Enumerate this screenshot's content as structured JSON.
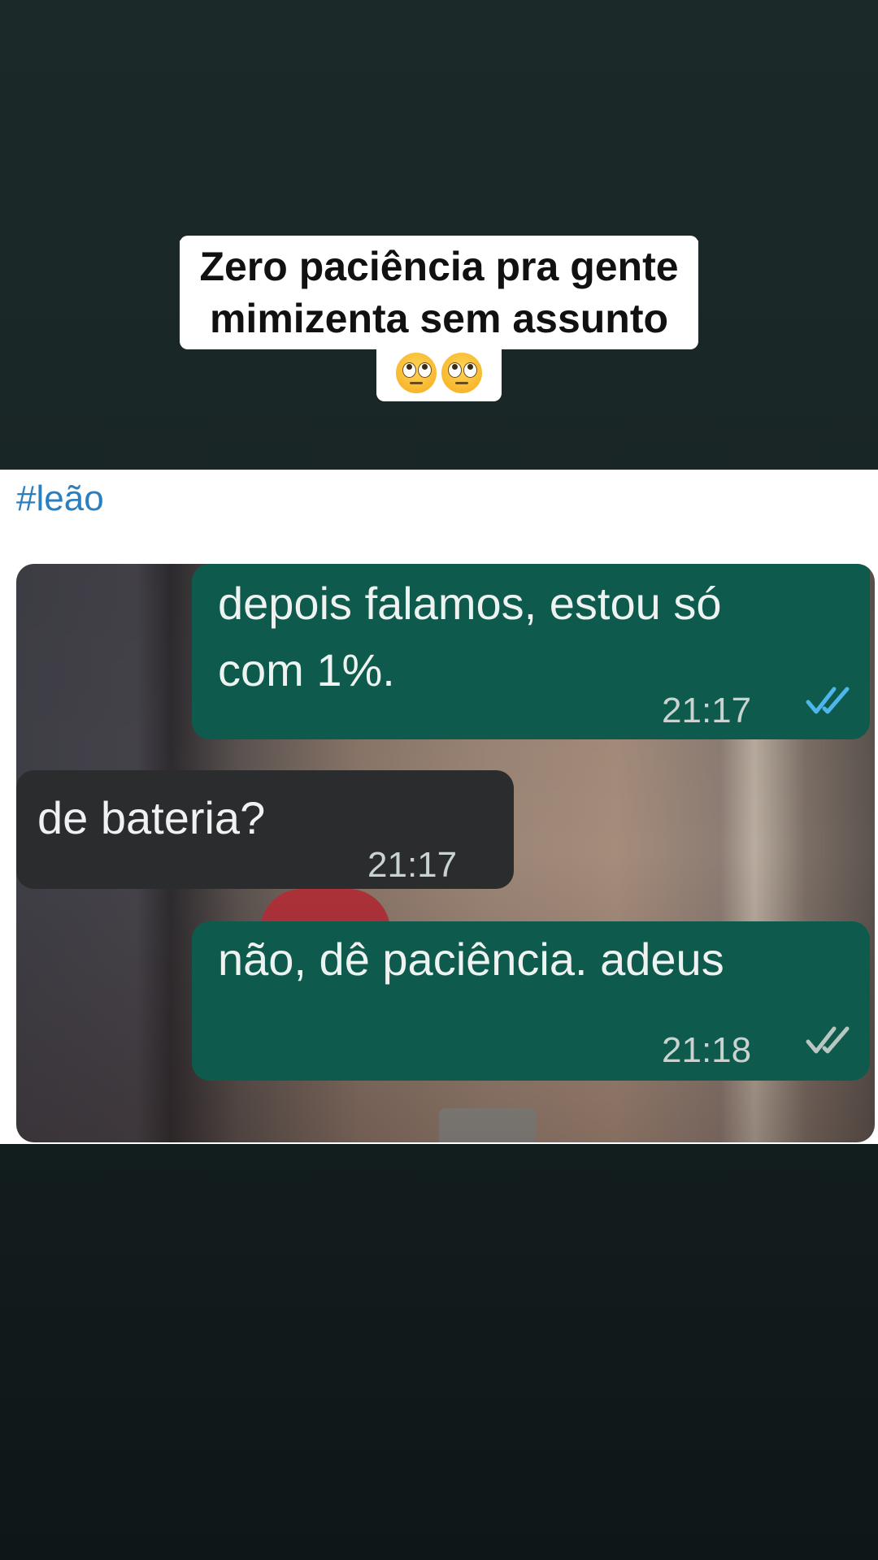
{
  "caption": {
    "line1": "Zero paciência pra gente",
    "line2": "mimizenta sem assunto",
    "emojis": [
      "face-with-rolling-eyes-icon",
      "face-with-rolling-eyes-icon"
    ]
  },
  "post": {
    "hashtag": "#leão"
  },
  "chat": {
    "messages": [
      {
        "direction": "outgoing",
        "line1": "depois falamos, estou só",
        "line2": "com 1%.",
        "time": "21:17",
        "status": "read",
        "tick_color": "#4fb6ec"
      },
      {
        "direction": "incoming",
        "text": "de bateria?",
        "time": "21:17"
      },
      {
        "direction": "outgoing",
        "text": "não, dê paciência. adeus",
        "time": "21:18",
        "status": "delivered",
        "tick_color": "#b9c6c2"
      }
    ]
  },
  "colors": {
    "page_bg_top": "#1b2928",
    "page_bg_bottom": "#0e1718",
    "outgoing_bubble": "#0e5a4c",
    "incoming_bubble": "#2a2c2e",
    "hashtag": "#2b7fbf"
  }
}
